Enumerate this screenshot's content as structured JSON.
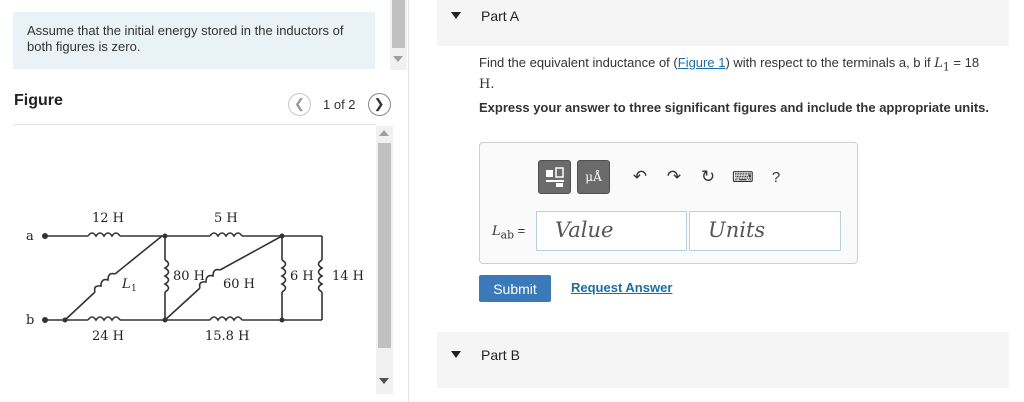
{
  "note": {
    "text": "Assume that the initial energy stored in the inductors of both figures is zero."
  },
  "figure": {
    "title": "Figure",
    "pager_text": "1 of 2",
    "labels": {
      "a": "a",
      "b": "b",
      "l12": "12 H",
      "l5": "5 H",
      "l1": "L",
      "l1_sub": "1",
      "l80": "80 H",
      "l60": "60 H",
      "l6": "6 H",
      "l14": "14 H",
      "l24": "24 H",
      "l158": "15.8 H"
    }
  },
  "partA": {
    "label": "Part A",
    "question_pre": "Find the equivalent inductance of (",
    "figure_link": "Figure 1",
    "question_mid": ") with respect to the terminals a, b if ",
    "l_sym": "L",
    "l_sub": "1",
    "question_eq": " = 18",
    "question_unit": "H.",
    "instruction": "Express your answer to three significant figures and include the appropriate units.",
    "answer_label": "L",
    "answer_sub": "ab",
    "answer_eq": " =",
    "value_placeholder": "Value",
    "units_placeholder": "Units",
    "submit": "Submit",
    "request": "Request Answer",
    "unit_btn": "μÅ",
    "help": "?"
  },
  "partB": {
    "label": "Part B"
  }
}
